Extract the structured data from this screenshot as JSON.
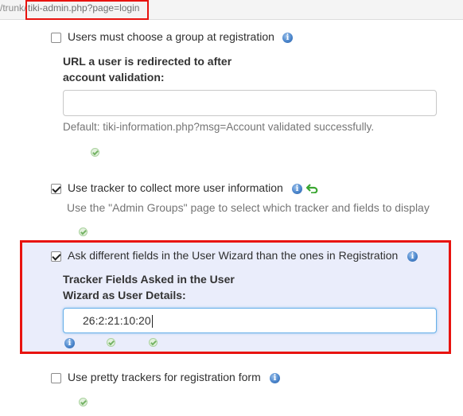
{
  "urlbar": {
    "prefix": "/trunk/",
    "page": "tiki-admin.php?page=login"
  },
  "options": {
    "group_at_registration": {
      "label": "Users must choose a group at registration",
      "checked": false
    },
    "redirect_url": {
      "label_line1": "URL a user is redirected to after",
      "label_line2": "account validation:",
      "value": "",
      "default_text": "Default: tiki-information.php?msg=Account validated successfully."
    },
    "use_tracker": {
      "label": "Use tracker to collect more user information",
      "checked": true,
      "hint": "Use the \"Admin Groups\" page to select which tracker and fields to display"
    },
    "wizard_fields": {
      "label": "Ask different fields in the User Wizard than the ones in Registration",
      "checked": true,
      "field_label_line1": "Tracker Fields Asked in the User",
      "field_label_line2": "Wizard as User Details:",
      "value": "26:2:21:10:20"
    },
    "pretty_trackers": {
      "label": "Use pretty trackers for registration form",
      "checked": false
    }
  },
  "icons": {
    "info": "info-icon",
    "ok": "ok-check-icon",
    "undo": "undo-arrow-icon"
  },
  "colors": {
    "highlight_border": "#e8130f",
    "highlight_bg": "#eaedfb",
    "info_blue": "#4b86cc",
    "ok_green": "#74b264",
    "undo_green": "#3aa631"
  }
}
